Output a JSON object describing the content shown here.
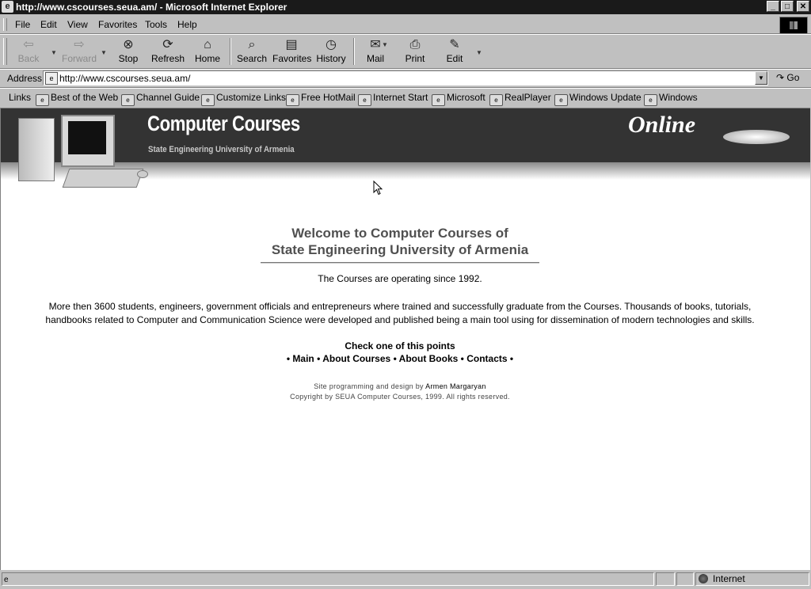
{
  "window": {
    "title": "http://www.cscourses.seua.am/ - Microsoft Internet Explorer",
    "app_icon": "ie-page-icon",
    "controls": [
      "_",
      "□",
      "✕"
    ]
  },
  "menu": [
    "File",
    "Edit",
    "View",
    "Favorites",
    "Tools",
    "Help"
  ],
  "toolbar": {
    "back": "Back",
    "forward": "Forward",
    "stop": "Stop",
    "refresh": "Refresh",
    "home": "Home",
    "search": "Search",
    "favorites": "Favorites",
    "history": "History",
    "mail": "Mail",
    "print": "Print",
    "edit": "Edit"
  },
  "address": {
    "label": "Address",
    "value": "http://www.cscourses.seua.am/",
    "go": "Go"
  },
  "links": {
    "label": "Links",
    "items": [
      "Best of the Web",
      "Channel Guide",
      "Customize Links",
      "Free HotMail",
      "Internet Start",
      "Microsoft",
      "RealPlayer",
      "Windows Update",
      "Windows"
    ]
  },
  "banner": {
    "title": "Computer Courses",
    "subtitle": "State Engineering University of Armenia",
    "online": "Online"
  },
  "content": {
    "welcome_line1": "Welcome to Computer Courses of",
    "welcome_line2": "State Engineering University of Armenia",
    "since": "The Courses are operating since 1992.",
    "desc_line1": "More then 3600 students, engineers, government officials and entrepreneurs where trained and successfully graduate from the Courses. Thousands of books, tutorials,",
    "desc_line2": "handbooks related to Computer and Communication Science were developed and published being a main tool using for dissemination of modern technologies and skills.",
    "check": "Check one of this points",
    "nav": [
      "Main",
      "About Courses",
      "About Books",
      "Contacts"
    ],
    "credit_prefix": "Site programming and design by",
    "credit_author": "Armen Margaryan",
    "copyright": "Copyright by SEUA Computer Courses, 1999. All rights reserved."
  },
  "status": {
    "zone": "Internet"
  },
  "colors": {
    "banner_bg": "#333333",
    "window_chrome": "#c0c0c0",
    "title_bar": "#1a1a1a",
    "welcome_text": "#505050"
  }
}
